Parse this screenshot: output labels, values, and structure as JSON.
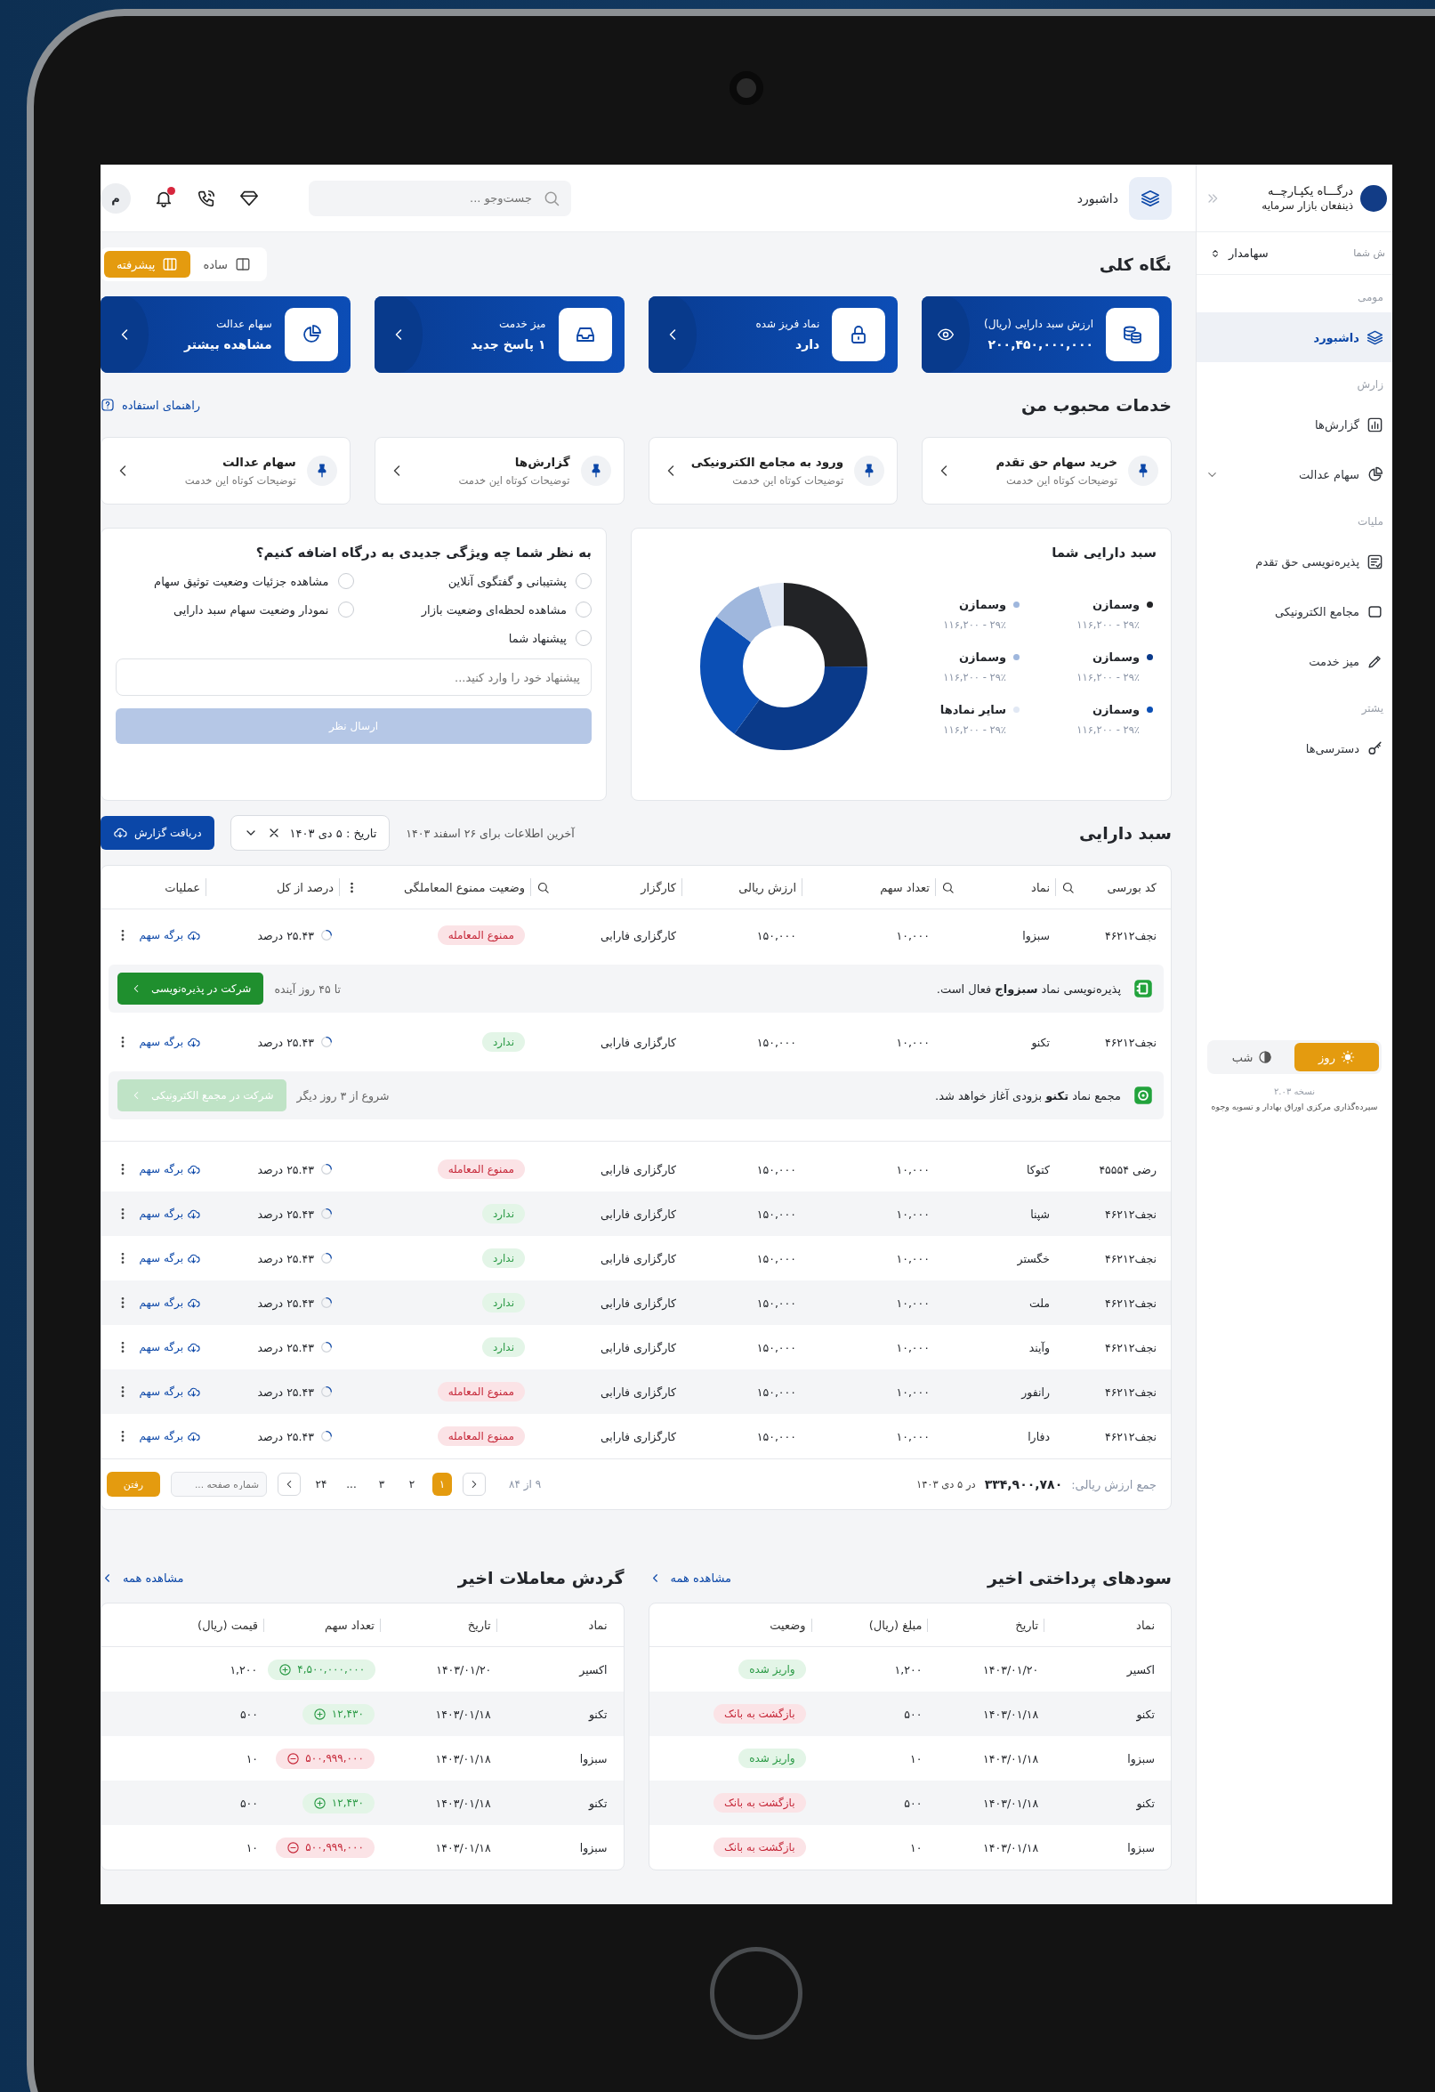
{
  "sidebar": {
    "logo_lines": [
      "درگـــاه یکپـارچــه",
      "ذینفعان بازار سرمایه"
    ],
    "role_label": "ش شما",
    "role_value": "سهامدار",
    "groups": [
      {
        "title": "مومی",
        "items": [
          {
            "label": "داشبورد",
            "selected": true
          }
        ]
      },
      {
        "title": "زارش",
        "items": [
          {
            "label": "گزارش‌ها",
            "selected": false
          },
          {
            "label": "سهام عدالت",
            "selected": false,
            "expanded": false
          }
        ]
      },
      {
        "title": "ملیات",
        "items": [
          {
            "label": "پذیره‌نویسی حق تقدم",
            "selected": false
          },
          {
            "label": "مجامع الکترونیکی",
            "selected": false
          },
          {
            "label": "میز خدمت",
            "selected": false
          }
        ]
      },
      {
        "title": "یشتر",
        "items": [
          {
            "label": "دسترسی‌ها",
            "selected": false
          }
        ]
      }
    ],
    "theme": [
      {
        "label": "روز",
        "selected": true
      },
      {
        "label": "شب",
        "selected": false
      }
    ],
    "version": "نسخه ۲.۰۳",
    "org": "سپرده‌گذاری مرکزی اوراق بهادار و تسویه وجوه"
  },
  "header": {
    "title": "داشبورد",
    "search_placeholder": "جست‌وجو ...",
    "avatar": "م",
    "unread_notifications": true
  },
  "overview": {
    "title": "نگاه کلی",
    "view_modes": [
      {
        "label": "ساده",
        "selected": false
      },
      {
        "label": "پیشرفته",
        "selected": true
      }
    ],
    "cards": [
      {
        "label": "ارزش سبد دارایی (ریال)",
        "value": "۲۰۰,۴۵۰,۰۰۰,۰۰۰",
        "kind": "balance"
      },
      {
        "label": "نماد فریز شده",
        "value": "دارد",
        "kind": "link"
      },
      {
        "label": "میز خدمت",
        "value": "۱ پاسخ جدید",
        "kind": "link"
      },
      {
        "label": "سهام عدالت",
        "value": "مشاهده بیشتر",
        "kind": "link"
      }
    ]
  },
  "favorites": {
    "title": "خدمات محبوب من",
    "help_link": "راهنمای استفاده",
    "items": [
      {
        "title": "خرید سهام حق تقدم",
        "description": "توضیحات کوتاه این خدمت"
      },
      {
        "title": "ورود به مجامع الکترونیکی",
        "description": "توضیحات کوتاه این خدمت"
      },
      {
        "title": "گزارش‌ها",
        "description": "توضیحات کوتاه این خدمت"
      },
      {
        "title": "سهام عدالت",
        "description": "توضیحات کوتاه این خدمت"
      }
    ]
  },
  "survey": {
    "question": "به نظر شما چه ویژگی جدیدی به درگاه اضافه کنیم؟",
    "options": [
      {
        "label": "پشتیبانی و گفتگوی آنلاین",
        "selected": false
      },
      {
        "label": "مشاهده جزئیات وضعیت توثیق سهام",
        "selected": false
      },
      {
        "label": "مشاهده لحظه‌ای وضعیت بازار",
        "selected": false
      },
      {
        "label": "نمودار وضعیت سهام سبد دارایی",
        "selected": false
      },
      {
        "label": "پیشنهاد شما",
        "selected": false
      }
    ],
    "placeholder": "پیشنهاد خود را وارد کنید...",
    "submit": {
      "label": "ارسال نظر",
      "disabled": true
    }
  },
  "portfolio_chart": {
    "title": "سبد دارایی شما",
    "legend": [
      {
        "name": "وسمازن",
        "value": "۲۹٪ - ۱۱۶,۲۰۰",
        "color": "#222326"
      },
      {
        "name": "وسمازن",
        "value": "۲۹٪ - ۱۱۶,۲۰۰",
        "color": "#9fb7dd"
      },
      {
        "name": "وسمازن",
        "value": "۲۹٪ - ۱۱۶,۲۰۰",
        "color": "#0a3a8a"
      },
      {
        "name": "وسمازن",
        "value": "۲۹٪ - ۱۱۶,۲۰۰",
        "color": "#9fb7dd"
      },
      {
        "name": "وسمازن",
        "value": "۲۹٪ - ۱۱۶,۲۰۰",
        "color": "#0b4fb5"
      },
      {
        "name": "سایر نمادها",
        "value": "۲۹٪ - ۱۱۶,۲۰۰",
        "color": "#e1e8f4"
      }
    ]
  },
  "assets": {
    "title": "سبد دارایی",
    "updated": "آخرین اطلاعات برای ۲۶ اسفند ۱۴۰۳",
    "date_filter": "تاریخ : ۵ دی ۱۴۰۳",
    "report_button": "دریافت گزارش",
    "columns": [
      {
        "label": "کد بورسی",
        "kind": "search"
      },
      {
        "label": "نماد",
        "kind": "search"
      },
      {
        "label": "تعداد سهم",
        "kind": "plain"
      },
      {
        "label": "ارزش ریالی",
        "kind": "plain"
      },
      {
        "label": "کارگزار",
        "kind": "search"
      },
      {
        "label": "وضعیت ممنوع المعاملگی",
        "kind": "menu"
      },
      {
        "label": "درصد از کل",
        "kind": "plain"
      },
      {
        "label": "عملیات",
        "kind": "plain"
      }
    ],
    "rows": [
      {
        "code": "نجف۴۶۲۱۲",
        "symbol": "سبزوا",
        "count": "۱۰,۰۰۰",
        "value": "۱۵۰,۰۰۰",
        "broker": "کارگزاری فارابی",
        "status": {
          "label": "ممنوع المعامله",
          "kind": "banned"
        },
        "percent": "۲۵.۴۳ درصد",
        "action": "برگه سهم",
        "notice": {
          "kind": "subscription",
          "text": "پذیره‌نویسی نماد **سبزواج** فعال است.",
          "note": "تا ۴۵ روز آینده",
          "button": "شرکت در پذیره‌نویسی",
          "disabled": false
        }
      },
      {
        "code": "نجف۴۶۲۱۲",
        "symbol": "تکنو",
        "count": "۱۰,۰۰۰",
        "value": "۱۵۰,۰۰۰",
        "broker": "کارگزاری فارابی",
        "status": {
          "label": "ندارد",
          "kind": "none"
        },
        "percent": "۲۵.۴۳ درصد",
        "action": "برگه سهم",
        "notice": {
          "kind": "assembly",
          "text": "مجمع نماد **تکنو** بزودی آغاز خواهد شد.",
          "note": "شروع از ۳ روز دیگر",
          "button": "شرکت در مجمع الکترونیکی",
          "disabled": true
        }
      },
      {
        "code": "رضی ۴۵۵۵۴",
        "symbol": "کتوکا",
        "count": "۱۰,۰۰۰",
        "value": "۱۵۰,۰۰۰",
        "broker": "کارگزاری فارابی",
        "status": {
          "label": "ممنوع المعامله",
          "kind": "banned"
        },
        "percent": "۲۵.۴۳ درصد",
        "action": "برگه سهم"
      },
      {
        "code": "نجف۴۶۲۱۲",
        "symbol": "شپنا",
        "count": "۱۰,۰۰۰",
        "value": "۱۵۰,۰۰۰",
        "broker": "کارگزاری فارابی",
        "status": {
          "label": "ندارد",
          "kind": "none"
        },
        "percent": "۲۵.۴۳ درصد",
        "action": "برگه سهم"
      },
      {
        "code": "نجف۴۶۲۱۲",
        "symbol": "خگستر",
        "count": "۱۰,۰۰۰",
        "value": "۱۵۰,۰۰۰",
        "broker": "کارگزاری فارابی",
        "status": {
          "label": "ندارد",
          "kind": "none"
        },
        "percent": "۲۵.۴۳ درصد",
        "action": "برگه سهم"
      },
      {
        "code": "نجف۴۶۲۱۲",
        "symbol": "ملت",
        "count": "۱۰,۰۰۰",
        "value": "۱۵۰,۰۰۰",
        "broker": "کارگزاری فارابی",
        "status": {
          "label": "ندارد",
          "kind": "none"
        },
        "percent": "۲۵.۴۳ درصد",
        "action": "برگه سهم"
      },
      {
        "code": "نجف۴۶۲۱۲",
        "symbol": "وآیند",
        "count": "۱۰,۰۰۰",
        "value": "۱۵۰,۰۰۰",
        "broker": "کارگزاری فارابی",
        "status": {
          "label": "ندارد",
          "kind": "none"
        },
        "percent": "۲۵.۴۳ درصد",
        "action": "برگه سهم"
      },
      {
        "code": "نجف۴۶۲۱۲",
        "symbol": "رانفور",
        "count": "۱۰,۰۰۰",
        "value": "۱۵۰,۰۰۰",
        "broker": "کارگزاری فارابی",
        "status": {
          "label": "ممنوع المعامله",
          "kind": "banned"
        },
        "percent": "۲۵.۴۳ درصد",
        "action": "برگه سهم"
      },
      {
        "code": "نجف۴۶۲۱۲",
        "symbol": "دفارا",
        "count": "۱۰,۰۰۰",
        "value": "۱۵۰,۰۰۰",
        "broker": "کارگزاری فارابی",
        "status": {
          "label": "ممنوع المعامله",
          "kind": "banned"
        },
        "percent": "۲۵.۴۳ درصد",
        "action": "برگه سهم"
      }
    ],
    "total_label": "جمع ارزش ریالی:",
    "total_value": "۳۳۴,۹۰۰,۷۸۰",
    "total_date": "در ۵ دی ۱۴۰۳",
    "page_info": "۹ از ۸۴",
    "pages": [
      {
        "label": "۱",
        "selected": true
      },
      {
        "label": "۲",
        "selected": false
      },
      {
        "label": "۳",
        "selected": false
      },
      {
        "label": "...",
        "selected": false
      },
      {
        "label": "۲۴",
        "selected": false
      }
    ],
    "page_placeholder": "شماره صفحه ...",
    "go_button": "رفتن"
  },
  "dividends": {
    "title": "سودهای پرداختی اخیر",
    "view_all": "مشاهده همه",
    "columns": [
      "نماد",
      "تاریخ",
      "مبلغ (ریال)",
      "وضعیت"
    ],
    "rows": [
      {
        "symbol": "اکسیر",
        "date": "۱۴۰۳/۰۱/۲۰",
        "amount": "۱,۲۰۰",
        "status": {
          "label": "واریز شده",
          "kind": "paid"
        }
      },
      {
        "symbol": "تکنو",
        "date": "۱۴۰۳/۰۱/۱۸",
        "amount": "۵۰۰",
        "status": {
          "label": "بازگشت به بانک",
          "kind": "returned"
        }
      },
      {
        "symbol": "سبزوا",
        "date": "۱۴۰۳/۰۱/۱۸",
        "amount": "۱۰",
        "status": {
          "label": "واریز شده",
          "kind": "paid"
        }
      },
      {
        "symbol": "تکنو",
        "date": "۱۴۰۳/۰۱/۱۸",
        "amount": "۵۰۰",
        "status": {
          "label": "بازگشت به بانک",
          "kind": "returned"
        }
      },
      {
        "symbol": "سبزوا",
        "date": "۱۴۰۳/۰۱/۱۸",
        "amount": "۱۰",
        "status": {
          "label": "بازگشت به بانک",
          "kind": "returned"
        }
      }
    ]
  },
  "trades": {
    "title": "گردش معاملات اخیر",
    "view_all": "مشاهده همه",
    "columns": [
      "نماد",
      "تاریخ",
      "تعداد سهم",
      "قیمت (ریال)"
    ],
    "rows": [
      {
        "symbol": "اکسیر",
        "date": "۱۴۰۳/۰۱/۲۰",
        "count": "۴,۵۰۰,۰۰۰,۰۰۰",
        "kind": "buy",
        "price": "۱,۲۰۰"
      },
      {
        "symbol": "تکنو",
        "date": "۱۴۰۳/۰۱/۱۸",
        "count": "۱۲,۴۳۰",
        "kind": "buy",
        "price": "۵۰۰"
      },
      {
        "symbol": "سبزوا",
        "date": "۱۴۰۳/۰۱/۱۸",
        "count": "۵۰۰,۹۹۹,۰۰۰",
        "kind": "sell",
        "price": "۱۰"
      },
      {
        "symbol": "تکنو",
        "date": "۱۴۰۳/۰۱/۱۸",
        "count": "۱۲,۴۳۰",
        "kind": "buy",
        "price": "۵۰۰"
      },
      {
        "symbol": "سبزوا",
        "date": "۱۴۰۳/۰۱/۱۸",
        "count": "۵۰۰,۹۹۹,۰۰۰",
        "kind": "sell",
        "price": "۱۰"
      }
    ]
  }
}
